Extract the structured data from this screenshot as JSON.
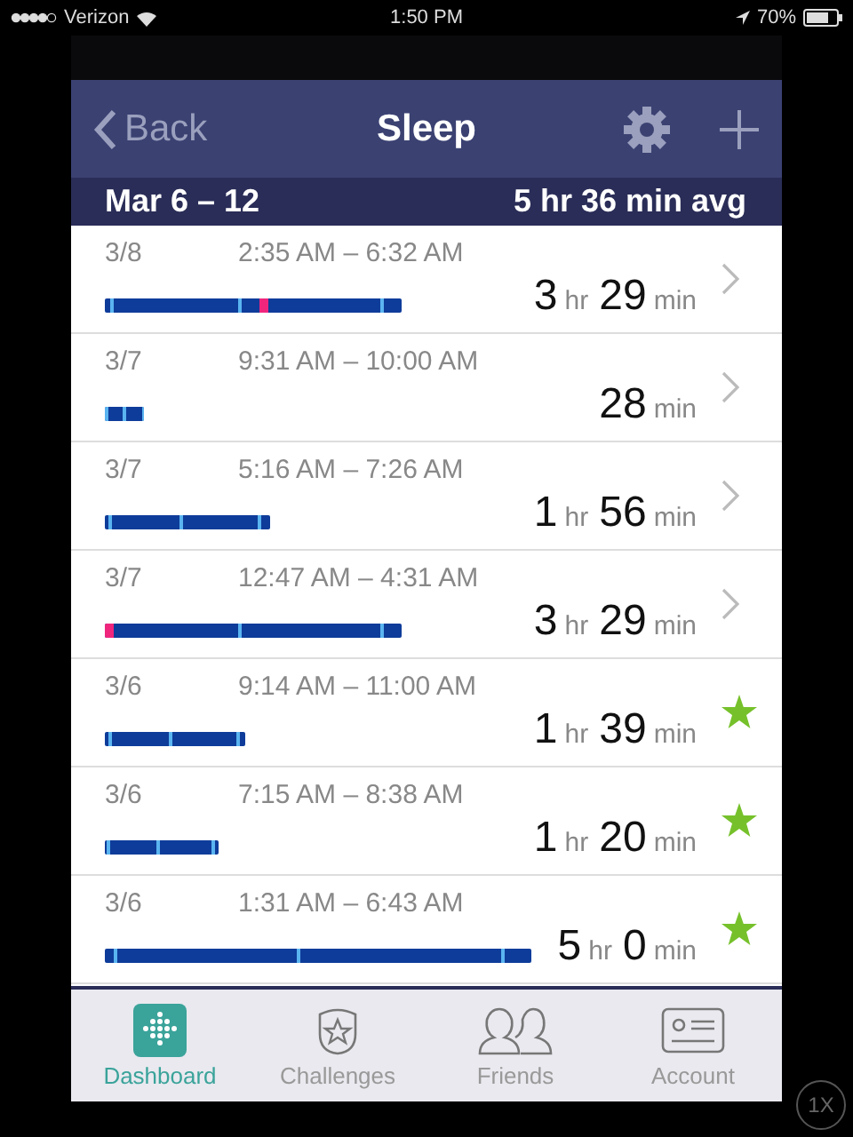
{
  "status_bar": {
    "carrier": "Verizon",
    "time": "1:50 PM",
    "battery": "70%"
  },
  "nav": {
    "back": "Back",
    "title": "Sleep"
  },
  "summary": {
    "range": "Mar 6 – 12",
    "average": "5 hr 36 min avg"
  },
  "entries": [
    {
      "date": "3/8",
      "times": "2:35 AM – 6:32 AM",
      "restless": true,
      "duration": [
        {
          "value": "3",
          "unit": "hr"
        },
        {
          "value": "29",
          "unit": "min"
        }
      ],
      "kind": "chevron"
    },
    {
      "date": "3/7",
      "times": "9:31 AM – 10:00 AM",
      "restless": false,
      "duration": [
        {
          "value": "28",
          "unit": "min"
        }
      ],
      "kind": "chevron"
    },
    {
      "date": "3/7",
      "times": "5:16 AM – 7:26 AM",
      "restless": false,
      "duration": [
        {
          "value": "1",
          "unit": "hr"
        },
        {
          "value": "56",
          "unit": "min"
        }
      ],
      "kind": "chevron"
    },
    {
      "date": "3/7",
      "times": "12:47 AM – 4:31 AM",
      "restless": true,
      "duration": [
        {
          "value": "3",
          "unit": "hr"
        },
        {
          "value": "29",
          "unit": "min"
        }
      ],
      "kind": "chevron"
    },
    {
      "date": "3/6",
      "times": "9:14 AM – 11:00 AM",
      "restless": false,
      "duration": [
        {
          "value": "1",
          "unit": "hr"
        },
        {
          "value": "39",
          "unit": "min"
        }
      ],
      "kind": "star"
    },
    {
      "date": "3/6",
      "times": "7:15 AM – 8:38 AM",
      "restless": false,
      "duration": [
        {
          "value": "1",
          "unit": "hr"
        },
        {
          "value": "20",
          "unit": "min"
        }
      ],
      "kind": "star"
    },
    {
      "date": "3/6",
      "times": "1:31 AM – 6:43 AM",
      "restless": false,
      "duration": [
        {
          "value": "5",
          "unit": "hr"
        },
        {
          "value": "0",
          "unit": "min"
        }
      ],
      "kind": "star"
    }
  ],
  "tabs": [
    {
      "label": "Dashboard",
      "selected": true
    },
    {
      "label": "Challenges",
      "selected": false
    },
    {
      "label": "Friends",
      "selected": false
    },
    {
      "label": "Account",
      "selected": false
    }
  ],
  "zoom_button": "1X"
}
